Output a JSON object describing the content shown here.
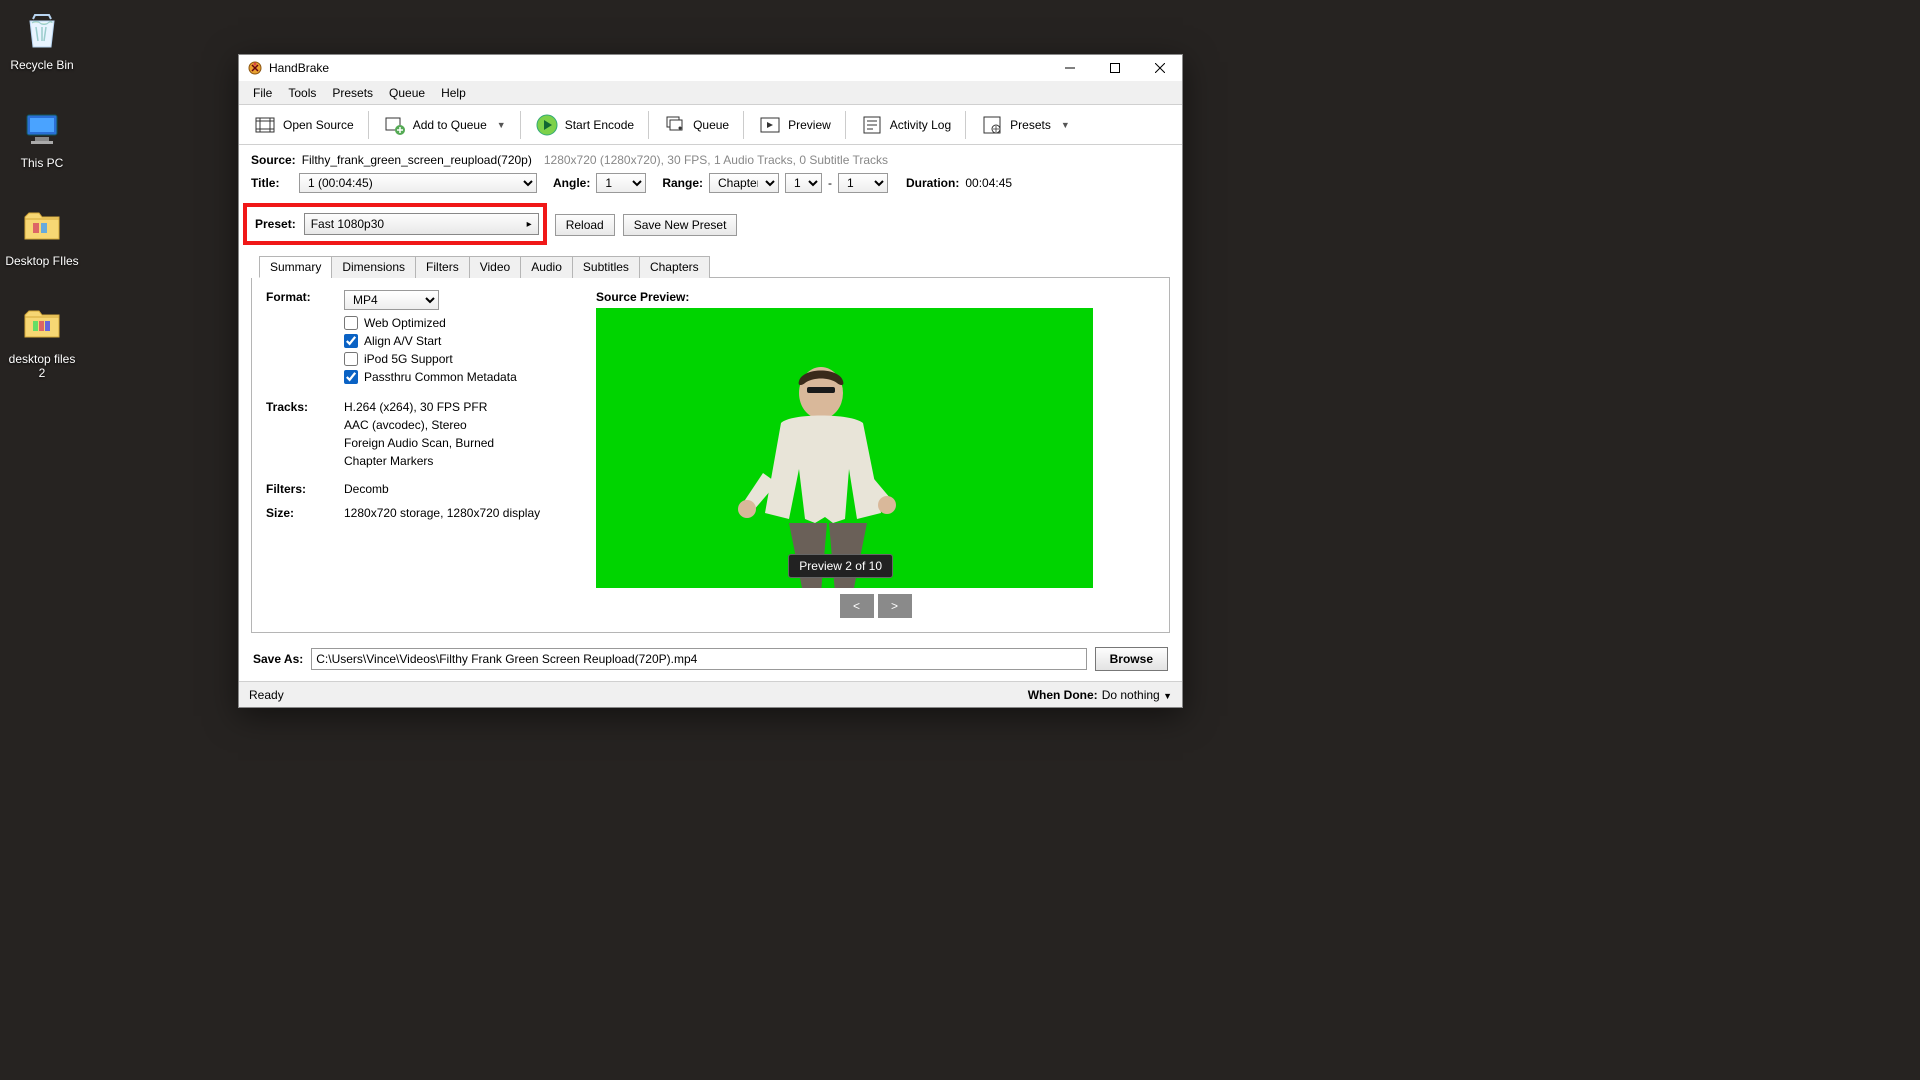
{
  "desktop": {
    "icons": [
      {
        "label": "Recycle Bin",
        "kind": "recycle"
      },
      {
        "label": "This PC",
        "kind": "pc"
      },
      {
        "label": "Desktop FIles",
        "kind": "folder"
      },
      {
        "label": "desktop files 2",
        "kind": "folder"
      }
    ]
  },
  "window": {
    "title": "HandBrake",
    "menu": [
      "File",
      "Tools",
      "Presets",
      "Queue",
      "Help"
    ],
    "toolbar": {
      "open": "Open Source",
      "add_queue": "Add to Queue",
      "start": "Start Encode",
      "queue": "Queue",
      "preview": "Preview",
      "activity": "Activity Log",
      "presets": "Presets"
    },
    "source": {
      "label": "Source:",
      "name": "Filthy_frank_green_screen_reupload(720p)",
      "meta": "1280x720 (1280x720), 30 FPS, 1 Audio Tracks, 0 Subtitle Tracks"
    },
    "title_row": {
      "label": "Title:",
      "value": "1  (00:04:45)",
      "angle_label": "Angle:",
      "angle": "1",
      "range_label": "Range:",
      "range_type": "Chapters",
      "range_from": "1",
      "range_dash": "-",
      "range_to": "1",
      "duration_label": "Duration:",
      "duration": "00:04:45"
    },
    "preset": {
      "label": "Preset:",
      "value": "Fast 1080p30",
      "reload": "Reload",
      "save_new": "Save New Preset"
    },
    "tabs": [
      "Summary",
      "Dimensions",
      "Filters",
      "Video",
      "Audio",
      "Subtitles",
      "Chapters"
    ],
    "summary": {
      "format_label": "Format:",
      "format": "MP4",
      "checks": {
        "web": "Web Optimized",
        "align": "Align A/V Start",
        "ipod": "iPod 5G Support",
        "passthru": "Passthru Common Metadata"
      },
      "check_state": {
        "web": false,
        "align": true,
        "ipod": false,
        "passthru": true
      },
      "tracks_label": "Tracks:",
      "tracks": [
        "H.264 (x264), 30 FPS PFR",
        "AAC (avcodec), Stereo",
        "Foreign Audio Scan, Burned",
        "Chapter Markers"
      ],
      "filters_label": "Filters:",
      "filters": "Decomb",
      "size_label": "Size:",
      "size": "1280x720 storage, 1280x720 display",
      "preview_label": "Source Preview:",
      "preview_badge": "Preview 2 of 10",
      "prev": "<",
      "next": ">"
    },
    "saveas": {
      "label": "Save As:",
      "path": "C:\\Users\\Vince\\Videos\\Filthy Frank Green Screen Reupload(720P).mp4",
      "browse": "Browse"
    },
    "status": {
      "ready": "Ready",
      "when_done_label": "When Done:",
      "when_done": "Do nothing"
    }
  }
}
